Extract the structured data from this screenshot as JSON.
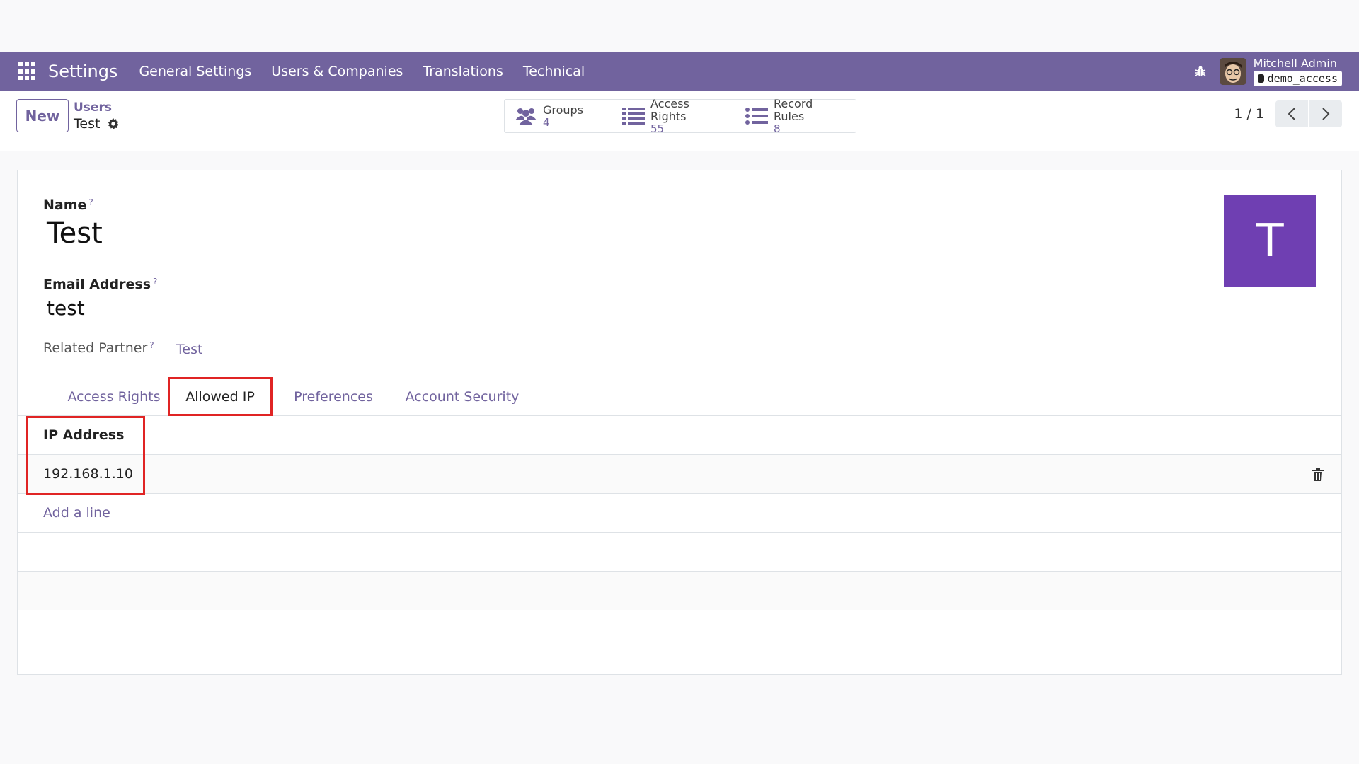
{
  "navbar": {
    "brand": "Settings",
    "menu": [
      "General Settings",
      "Users & Companies",
      "Translations",
      "Technical"
    ],
    "user_name": "Mitchell Admin",
    "database": "demo_access"
  },
  "control_panel": {
    "new_label": "New",
    "breadcrumb_parent": "Users",
    "breadcrumb_current": "Test",
    "smart_buttons": [
      {
        "label": "Groups",
        "value": "4"
      },
      {
        "label": "Access Rights",
        "value": "55"
      },
      {
        "label": "Record Rules",
        "value": "8"
      }
    ],
    "pager": "1 / 1"
  },
  "form": {
    "name_label": "Name",
    "help_mark": "?",
    "name_value": "Test",
    "email_label": "Email Address",
    "email_value": "test",
    "partner_label": "Related Partner",
    "partner_value": "Test",
    "avatar_letter": "T",
    "avatar_color": "#6f3fb2",
    "tabs": [
      "Access Rights",
      "Allowed IP",
      "Preferences",
      "Account Security"
    ],
    "active_tab": "Allowed IP",
    "table": {
      "column": "IP Address",
      "rows": [
        "192.168.1.10"
      ],
      "add_line": "Add a line"
    }
  },
  "colors": {
    "brand_purple": "#71639e",
    "highlight_red": "#e02424"
  }
}
